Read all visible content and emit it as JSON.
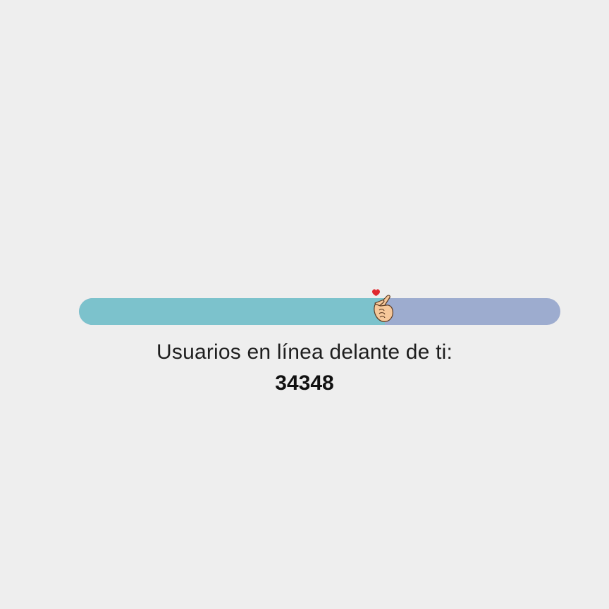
{
  "queue": {
    "label": "Usuarios en línea delante de ti:",
    "count": "34348",
    "progress_fraction": 0.635,
    "colors": {
      "background": "#eeeeee",
      "fill": "#7cc2cc",
      "track": "#9daccf",
      "heart": "#e0282e",
      "hand": "#f6c89a"
    },
    "marker_icon": "finger-heart-icon"
  }
}
